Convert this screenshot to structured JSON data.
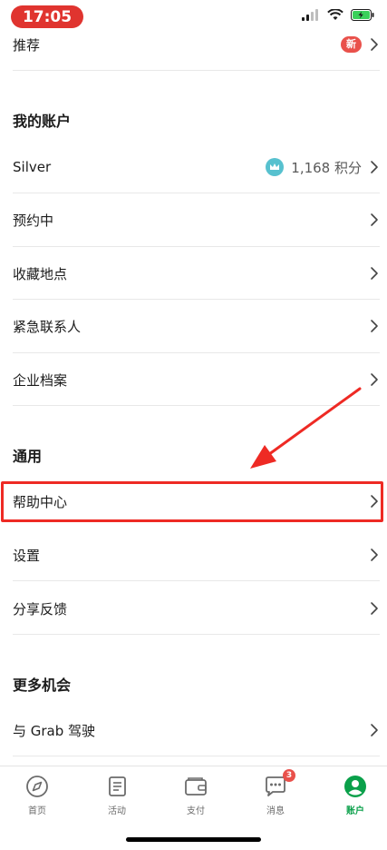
{
  "status_bar": {
    "time": "17:05"
  },
  "rows": {
    "recommend": {
      "label": "推荐",
      "badge": "新"
    },
    "silver": {
      "label": "Silver",
      "points": "1,168 积分"
    },
    "booked": {
      "label": "预约中"
    },
    "saved_places": {
      "label": "收藏地点"
    },
    "emergency": {
      "label": "紧急联系人"
    },
    "business": {
      "label": "企业档案"
    },
    "help": {
      "label": "帮助中心"
    },
    "settings": {
      "label": "设置"
    },
    "feedback": {
      "label": "分享反馈"
    },
    "drive": {
      "label": "与 Grab 驾驶"
    }
  },
  "sections": {
    "my_account": "我的账户",
    "general": "通用",
    "more_opportunities": "更多机会"
  },
  "bottom_nav": {
    "items": [
      {
        "label": "首页",
        "icon": "compass-icon"
      },
      {
        "label": "活动",
        "icon": "activity-icon"
      },
      {
        "label": "支付",
        "icon": "wallet-icon"
      },
      {
        "label": "消息",
        "icon": "chat-icon",
        "badge": "3"
      },
      {
        "label": "账户",
        "icon": "account-icon",
        "active": true
      }
    ]
  },
  "colors": {
    "accent": "#0aa04a",
    "highlight": "#ee2a24",
    "badge": "#e9514b",
    "crown": "#57c1cf"
  }
}
